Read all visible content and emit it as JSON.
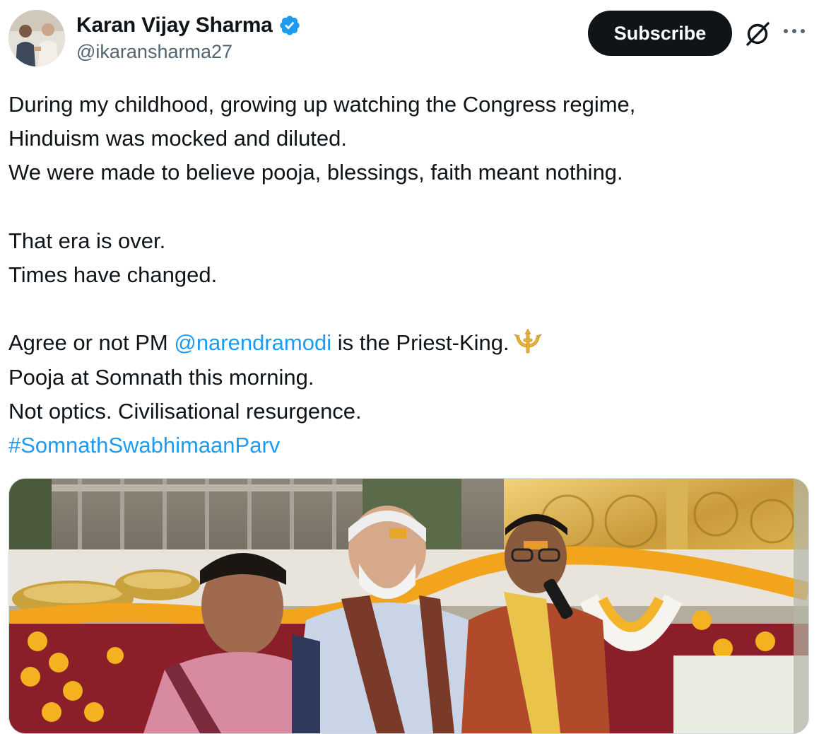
{
  "author": {
    "display_name": "Karan Vijay Sharma",
    "handle": "@ikaransharma27",
    "verified": true,
    "verified_color": "#1d9bf0"
  },
  "actions": {
    "subscribe_label": "Subscribe",
    "grok_icon": "grok-slash-circle-icon",
    "more_icon": "more-horizontal-icon"
  },
  "tweet": {
    "lines": [
      "During my childhood, growing up watching the Congress regime,",
      "Hinduism was mocked and diluted.",
      "We were made to believe pooja, blessings, faith meant nothing.",
      "That era is over.",
      "Times have changed.",
      "Agree or not PM ",
      "@narendramodi",
      " is the Priest-King.",
      "Pooja at Somnath this morning.",
      "Not optics. Civilisational resurgence.",
      "#SomnathSwabhimaanParv"
    ],
    "emoji": "trident-emoji-icon"
  },
  "colors": {
    "text": "#0f1419",
    "secondary": "#536471",
    "link": "#1d9bf0",
    "button_bg": "#0f1419",
    "button_text": "#ffffff"
  }
}
